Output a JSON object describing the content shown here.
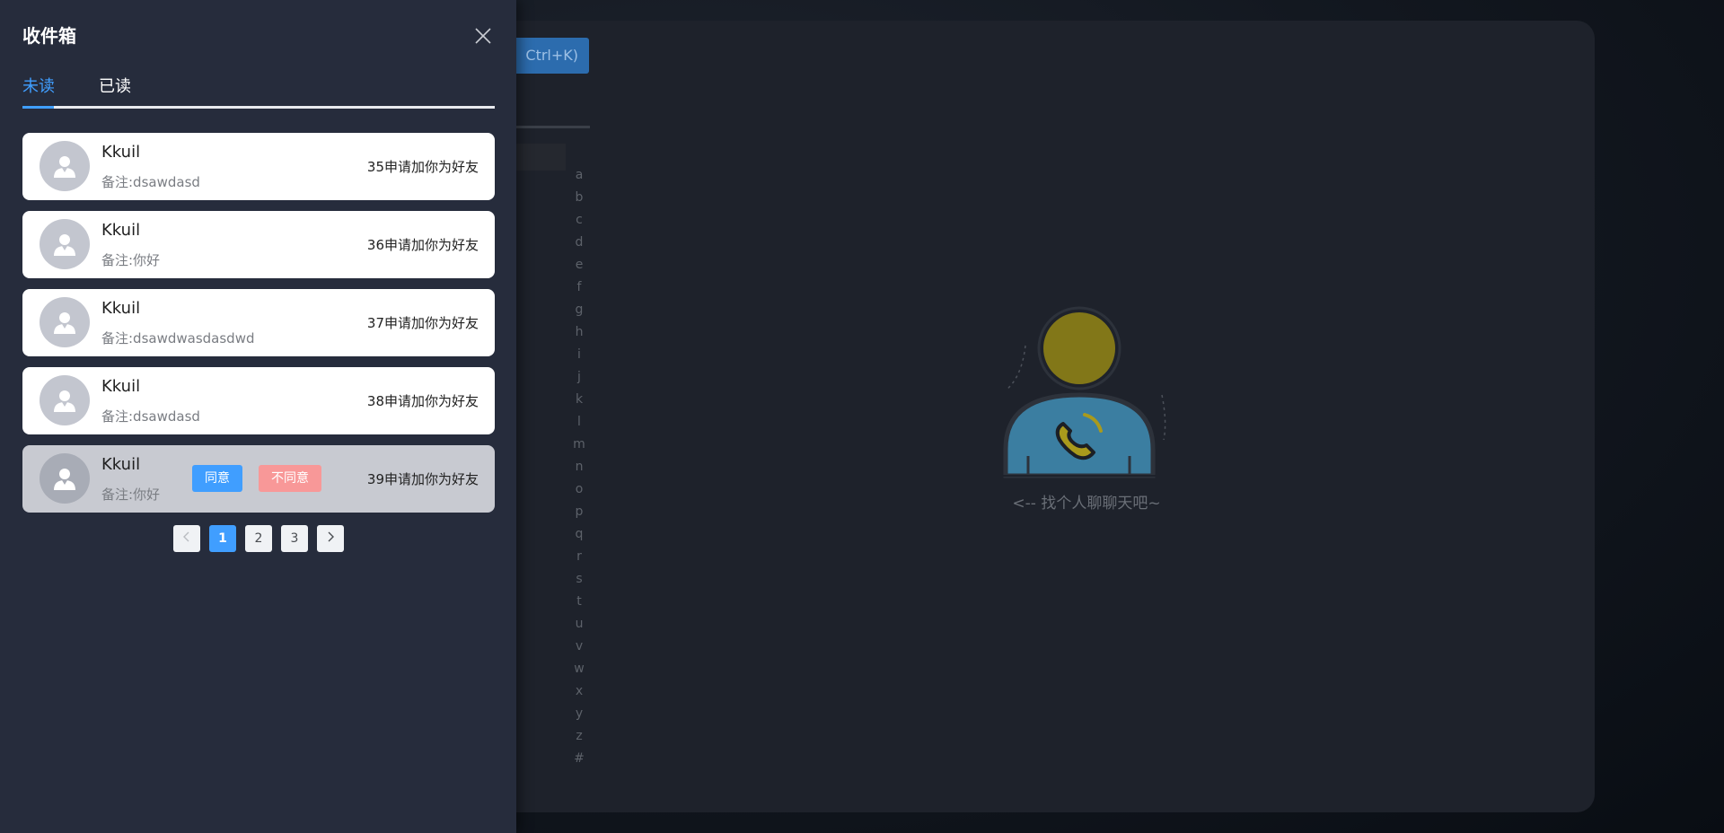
{
  "background": {
    "search_shortcut": "Ctrl+K)",
    "alpha_index": [
      "a",
      "b",
      "c",
      "d",
      "e",
      "f",
      "g",
      "h",
      "i",
      "j",
      "k",
      "l",
      "m",
      "n",
      "o",
      "p",
      "q",
      "r",
      "s",
      "t",
      "u",
      "v",
      "w",
      "x",
      "y",
      "z",
      "#"
    ],
    "empty_hint": "<-- 找个人聊聊天吧~",
    "colors": {
      "illustration_head": "#827718",
      "illustration_body": "#3b7ea1"
    }
  },
  "drawer": {
    "title": "收件箱",
    "close_icon": "close-icon",
    "tabs": [
      {
        "label": "未读",
        "active": true
      },
      {
        "label": "已读",
        "active": false
      }
    ],
    "requests": [
      {
        "name": "Kkuil",
        "note": "备注:dsawdasd",
        "message": "35申请加你为好友"
      },
      {
        "name": "Kkuil",
        "note": "备注:你好",
        "message": "36申请加你为好友"
      },
      {
        "name": "Kkuil",
        "note": "备注:dsawdwasdasdwd",
        "message": "37申请加你为好友"
      },
      {
        "name": "Kkuil",
        "note": "备注:dsawdasd",
        "message": "38申请加你为好友"
      },
      {
        "name": "Kkuil",
        "note": "备注:你好",
        "message": "39申请加你为好友",
        "hovered": true,
        "accept_label": "同意",
        "reject_label": "不同意"
      }
    ],
    "pagination": {
      "prev_icon": "chevron-left-icon",
      "next_icon": "chevron-right-icon",
      "pages": [
        "1",
        "2",
        "3"
      ],
      "current": "1"
    },
    "colors": {
      "accent": "#409eff",
      "reject": "#f89898",
      "drawer_bg": "#262c3c"
    }
  }
}
